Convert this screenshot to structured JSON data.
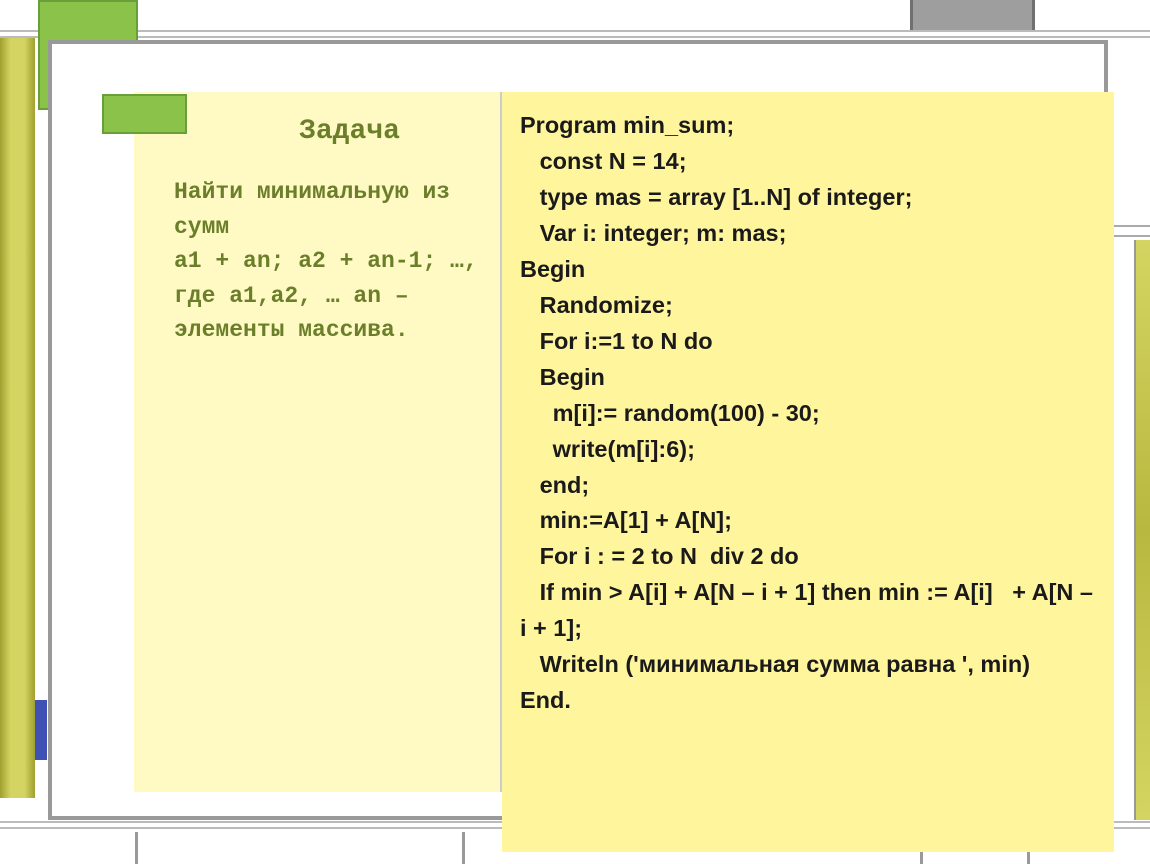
{
  "task": {
    "title": "Задача",
    "body_lines": [
      "Найти минимальную из сумм",
      "a1 + an; a2 + an-1; …, где a1,a2, … an – элементы массива."
    ]
  },
  "code_lines": [
    "Program min_sum;",
    "   const N = 14;",
    "   type mas = array [1..N] of integer;",
    "   Var i: integer; m: mas;",
    "Begin",
    "   Randomize;",
    "   For i:=1 to N do",
    "   Begin",
    "     m[i]:= random(100) - 30;",
    "     write(m[i]:6);",
    "   end;",
    "   min:=A[1] + A[N];",
    "   For i : = 2 to N  div 2 do",
    "   If min > A[i] + A[N – i + 1] then min := A[i]   + A[N – i + 1];",
    "   Writeln ('минимальная сумма равна ', min)",
    "End."
  ]
}
